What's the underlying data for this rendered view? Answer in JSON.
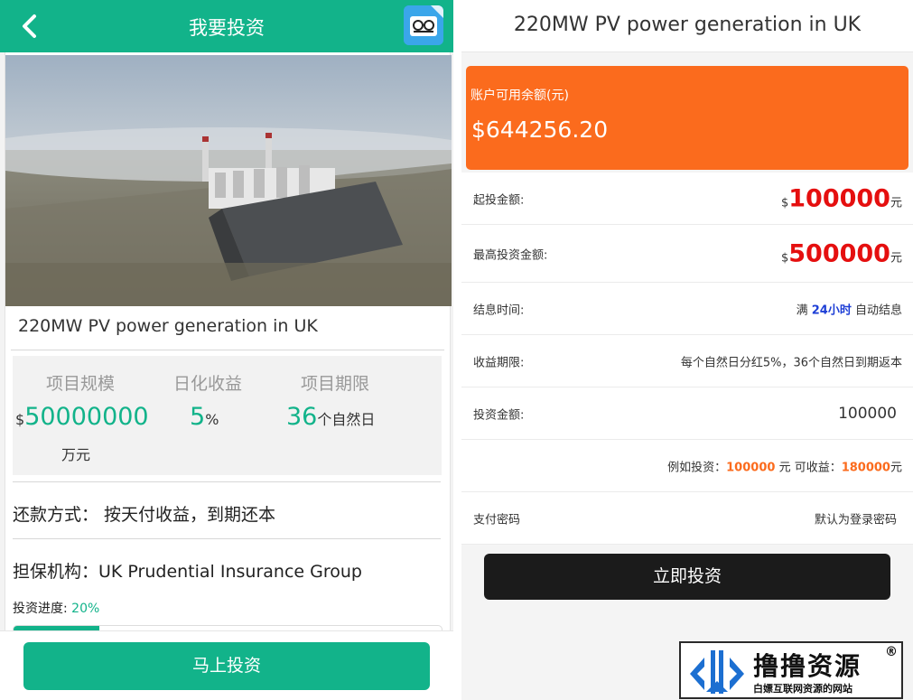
{
  "left": {
    "header": {
      "title": "我要投资"
    },
    "project": {
      "title": "220MW PV power generation in UK"
    },
    "stats": {
      "scale_label": "项目规模",
      "scale_currency": "$",
      "scale_value": "50000000",
      "scale_unit": "万元",
      "yield_label": "日化收益",
      "yield_value": "5",
      "yield_unit": "%",
      "term_label": "项目期限",
      "term_value": "36",
      "term_unit": "个自然日"
    },
    "repayment": "还款方式：  按天付收益，到期还本",
    "guarantor": "担保机构：UK Prudential Insurance Group",
    "progress": {
      "label": "投资进度:",
      "value_text": "20%",
      "value": 0.2
    },
    "invest_button": "马上投资"
  },
  "right": {
    "header": {
      "title": "220MW PV power generation in UK"
    },
    "balance": {
      "label": "账户可用余额(元)",
      "value": "$644256.20"
    },
    "min_invest": {
      "label": "起投金额:",
      "currency": "$",
      "value": "100000",
      "unit": "元"
    },
    "max_invest": {
      "label": "最高投资金额:",
      "currency": "$",
      "value": "500000",
      "unit": "元"
    },
    "settlement": {
      "label": "结息时间:",
      "pre": "满",
      "hours": "24小时",
      "post": "自动结息"
    },
    "term": {
      "label": "收益期限:",
      "value": "每个自然日分红5%，36个自然日到期返本"
    },
    "amount": {
      "label": "投资金额:",
      "value": "100000"
    },
    "example": {
      "pre": "例如投资：",
      "amount": "100000",
      "mid": "元 可收益：",
      "income": "180000",
      "unit": "元"
    },
    "password": {
      "label": "支付密码",
      "placeholder": "默认为登录密码"
    },
    "confirm_button": "立即投资"
  },
  "watermark": {
    "name": "撸撸资源",
    "reg": "®",
    "sub": "白嫖互联网资源的网站"
  },
  "colors": {
    "green": "#12b38a",
    "orange": "#fb6b1d",
    "red": "#e50f0f",
    "blue": "#1e3fd6",
    "dark": "#1b1b1b"
  }
}
